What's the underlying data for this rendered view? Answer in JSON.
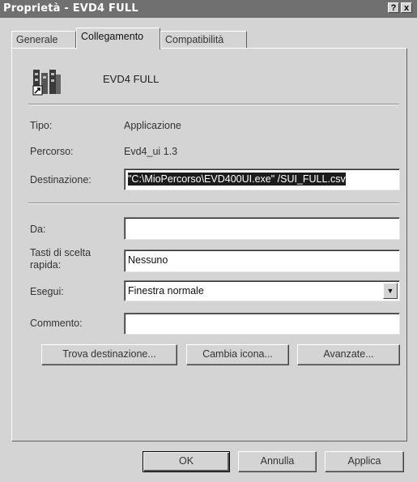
{
  "window": {
    "title": "Proprietà - EVD4 FULL",
    "help_button": "?",
    "close_button": "x"
  },
  "tabs": [
    "Generale",
    "Collegamento",
    "Compatibilità"
  ],
  "shortcut": {
    "icon": "application-shortcut-icon",
    "name": "EVD4 FULL"
  },
  "info": {
    "tipo_label": "Tipo:",
    "tipo_value": "Applicazione",
    "percorso_label": "Percorso:",
    "percorso_value": "Evd4_ui 1.3",
    "destinazione_label": "Destinazione:",
    "destinazione_value": "\"C:\\MioPercorso\\EVD400UI.exe\" /SUI_FULL.csv"
  },
  "fields": {
    "da_label": "Da:",
    "da_value": "",
    "tasti_label": "Tasti di scelta rapida:",
    "tasti_value": "Nessuno",
    "esegui_label": "Esegui:",
    "esegui_value": "Finestra normale",
    "commento_label": "Commento:",
    "commento_value": ""
  },
  "buttons": {
    "trova": "Trova destinazione...",
    "cambia": "Cambia icona...",
    "avanzate": "Avanzate...",
    "ok": "OK",
    "annulla": "Annulla",
    "applica": "Applica"
  }
}
